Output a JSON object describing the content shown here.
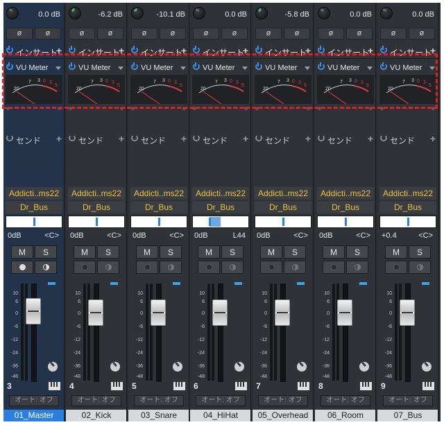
{
  "labels": {
    "inserts": "インサート",
    "insert_plugin": "VU Meter",
    "sends": "センド",
    "add": "+",
    "phase": "ø",
    "mute": "M",
    "solo": "S",
    "automation": "オート: オフ",
    "plugin_name": "Addicti..ms22",
    "bus_name": "Dr_Bus"
  },
  "vu_scale": [
    "20",
    "7",
    "3",
    "0",
    "3",
    "5"
  ],
  "fader_scale": [
    "10",
    "6",
    "0",
    "-6",
    "-12",
    "-24",
    "-36",
    "-48"
  ],
  "channels": [
    {
      "name": "01_Master",
      "number": "3",
      "gain": "0.0 dB",
      "volume": "0dB",
      "pan": "<C>",
      "selected": true,
      "pan_value": 0
    },
    {
      "name": "02_Kick",
      "number": "4",
      "gain": "-6.2 dB",
      "volume": "0dB",
      "pan": "<C>",
      "selected": false,
      "pan_value": 0
    },
    {
      "name": "03_Snare",
      "number": "5",
      "gain": "-10.1 dB",
      "volume": "0dB",
      "pan": "<C>",
      "selected": false,
      "pan_value": 0
    },
    {
      "name": "04_HiHat",
      "number": "6",
      "gain": "0.0 dB",
      "volume": "0dB",
      "pan": "L44",
      "selected": false,
      "pan_value": -44
    },
    {
      "name": "05_Overhead",
      "number": "7",
      "gain": "-5.8 dB",
      "volume": "0dB",
      "pan": "<C>",
      "selected": false,
      "pan_value": 0
    },
    {
      "name": "06_Room",
      "number": "8",
      "gain": "0.0 dB",
      "volume": "0dB",
      "pan": "<C>",
      "selected": false,
      "pan_value": 0
    },
    {
      "name": "07_Bus",
      "number": "9",
      "gain": "0.0 dB",
      "volume": "+0.4",
      "pan": "<C>",
      "selected": false,
      "pan_value": 0
    }
  ],
  "colors": {
    "plugin_text": "#f0c040",
    "selected_name_bg": "#2b7fe0",
    "highlight": "#e02020",
    "power_on": "#3d8fe8"
  }
}
